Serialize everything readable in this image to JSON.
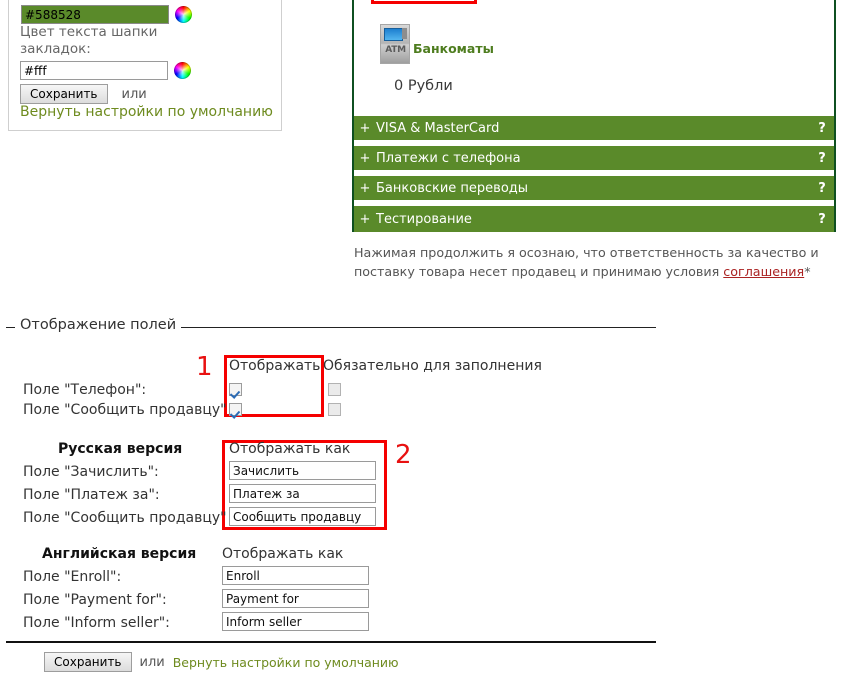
{
  "settings_panel": {
    "header_color_value": "#588528",
    "text_color_label": "Цвет текста шапки закладок:",
    "text_color_value": "#fff",
    "save_label": "Сохранить",
    "or_label": "или",
    "reset_label": "Вернуть настройки по умолчанию",
    "color_picker_icon": "color-wheel-icon"
  },
  "payment_panel": {
    "atm_icon": "atm-icon",
    "atm_badge": "ATM",
    "atm_label": "Банкоматы",
    "amount": "0 Рубли",
    "accordion": [
      {
        "plus": "+",
        "label": "VISA & MasterCard",
        "help": "?"
      },
      {
        "plus": "+",
        "label": "Платежи с телефона",
        "help": "?"
      },
      {
        "plus": "+",
        "label": "Банковские переводы",
        "help": "?"
      },
      {
        "plus": "+",
        "label": "Тестирование",
        "help": "?"
      }
    ],
    "disclaimer_part1": "Нажимая продолжить я осознаю, что ответственность за качество и поставку товара несет продавец и принимаю условия ",
    "disclaimer_link": "соглашения",
    "disclaimer_part2": "*",
    "accent_green": "#5a8a2a",
    "border_green": "#0f5021"
  },
  "fields_section": {
    "legend": "Отображение полей",
    "col_show": "Отображать",
    "col_required": "Обязательно для заполнения",
    "rows": [
      {
        "label": "Поле \"Телефон\":",
        "show": true,
        "required": false
      },
      {
        "label": "Поле \"Сообщить продавцу\"",
        "show": true,
        "required": false
      }
    ],
    "russian": {
      "title": "Русская версия",
      "col_display_as": "Отображать как",
      "rows": [
        {
          "label": "Поле \"Зачислить\":",
          "value": "Зачислить"
        },
        {
          "label": "Поле \"Платеж за\":",
          "value": "Платеж за"
        },
        {
          "label": "Поле \"Сообщить продавцу\"",
          "value": "Сообщить продавцу"
        }
      ]
    },
    "english": {
      "title": "Английская версия",
      "col_display_as": "Отображать как",
      "rows": [
        {
          "label": "Поле \"Enroll\":",
          "value": "Enroll"
        },
        {
          "label": "Поле \"Payment for\":",
          "value": "Payment for"
        },
        {
          "label": "Поле \"Inform seller\":",
          "value": "Inform seller"
        }
      ]
    },
    "annotations": [
      {
        "number": "1",
        "color": "#e81111"
      },
      {
        "number": "2",
        "color": "#e81111"
      }
    ],
    "save_label": "Сохранить",
    "or_label": "или",
    "reset_label": "Вернуть настройки по умолчанию"
  }
}
